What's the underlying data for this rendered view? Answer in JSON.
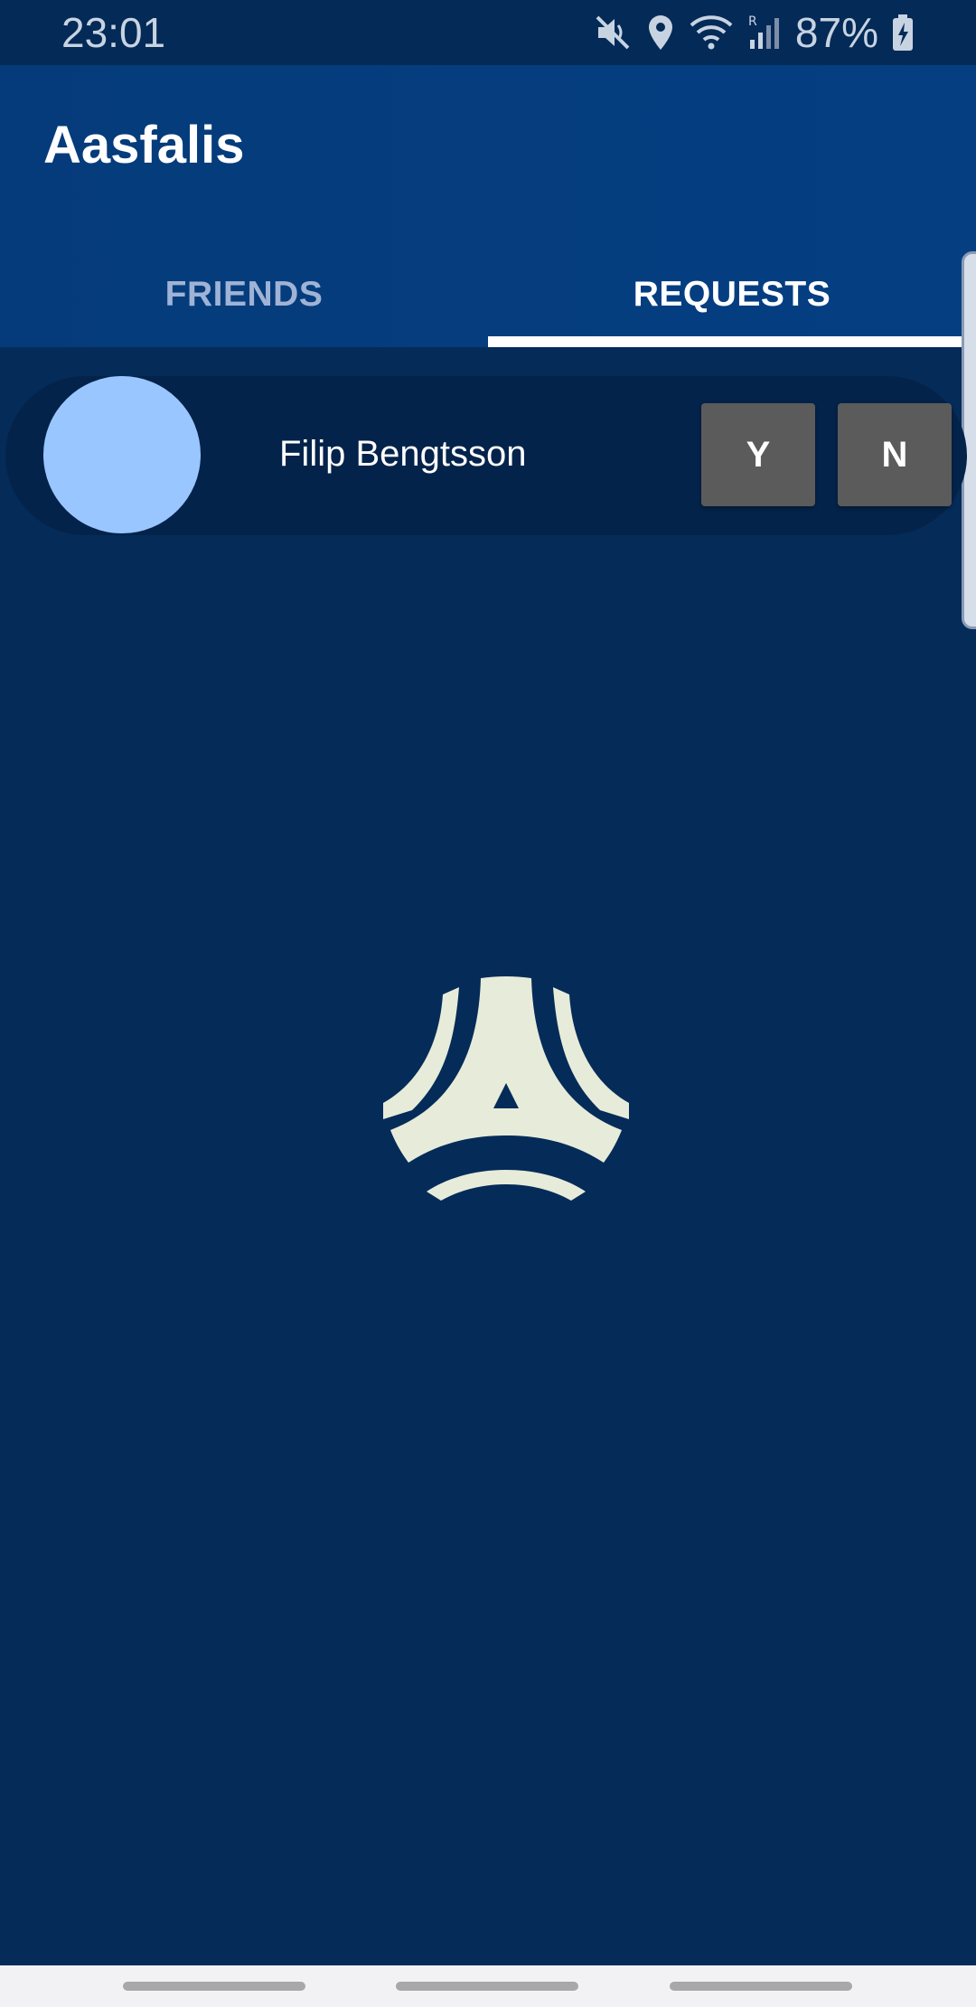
{
  "status_bar": {
    "time": "23:01",
    "battery": "87%",
    "icons": [
      "mute-icon",
      "location-icon",
      "wifi-icon",
      "signal-icon",
      "battery-charging-icon"
    ]
  },
  "app": {
    "title": "Aasfalis"
  },
  "tabs": [
    {
      "label": "FRIENDS",
      "selected": false
    },
    {
      "label": "REQUESTS",
      "selected": true
    }
  ],
  "requests": [
    {
      "name": "Filip Bengtsson",
      "accept_label": "Y",
      "decline_label": "N"
    }
  ],
  "colors": {
    "background": "#052b59",
    "app_bar": "#053f82",
    "accent_text": "#ffffff",
    "avatar": "#9ac6ff",
    "button": "#5b5b5b",
    "logo": "#e6ecd9"
  },
  "logo": {
    "icon": "aasfalis-logo-icon"
  }
}
